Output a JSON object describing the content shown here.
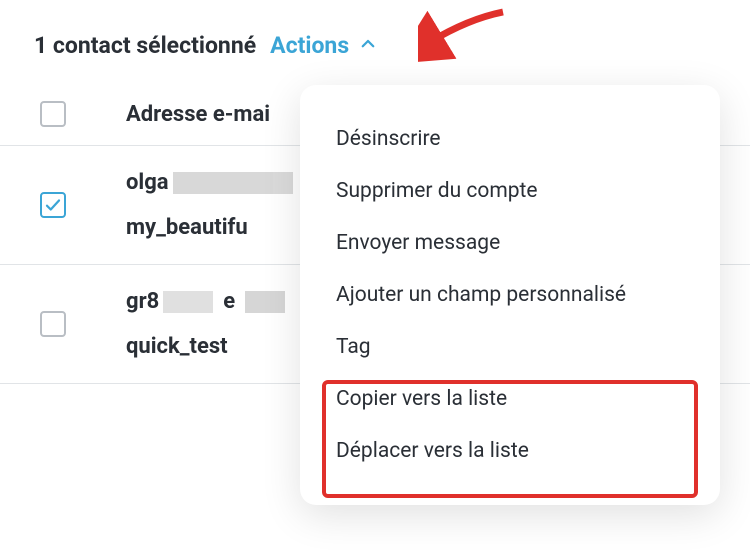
{
  "header": {
    "selected_text": "1 contact sélectionné",
    "actions_label": "Actions"
  },
  "columns": {
    "email_header": "Adresse e-mai"
  },
  "rows": [
    {
      "checked": true,
      "line1_prefix": "olga",
      "line2": "my_beautifu"
    },
    {
      "checked": false,
      "line1_prefix": "gr8",
      "line1_mid": "e",
      "line2": "quick_test"
    }
  ],
  "dropdown": {
    "items": [
      "Désinscrire",
      "Supprimer du compte",
      "Envoyer message",
      "Ajouter un champ personnalisé",
      "Tag",
      "Copier vers la liste",
      "Déplacer vers la liste"
    ]
  }
}
